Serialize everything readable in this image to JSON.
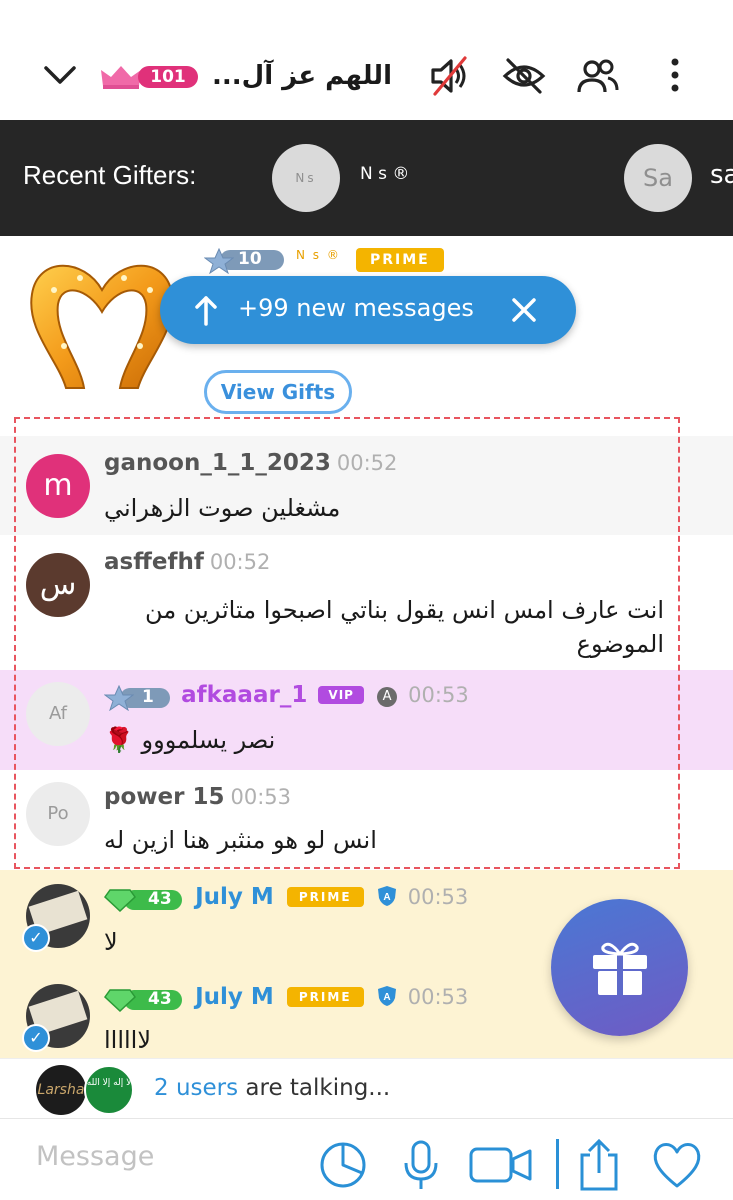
{
  "header": {
    "room_title": "اللهم عز آل...",
    "level": "101",
    "icons": [
      "chevron-down-icon",
      "crown-icon",
      "mute-speaker-icon",
      "eye-off-icon",
      "users-icon",
      "more-vertical-icon"
    ]
  },
  "gifters": {
    "label": "Recent Gifters:",
    "items": [
      {
        "initials": "Ns",
        "name": "N s ®"
      },
      {
        "initials": "Sa",
        "name": "sa"
      }
    ]
  },
  "gift_message": {
    "star_level": "10",
    "name": "N s ®",
    "badge": "PRIME",
    "view_gifts": "View Gifts"
  },
  "new_messages": {
    "label": "+99 new messages"
  },
  "messages": [
    {
      "initial": "m",
      "avatar_color": "#e0317a",
      "username": "ganoon_1_1_2023",
      "time": "00:52",
      "text": "مشغلين صوت الزهراني"
    },
    {
      "initial": "س",
      "avatar_color": "#5b3a2e",
      "username": "asffefhf",
      "time": "00:52",
      "text": "انت عارف امس انس يقول  بناتي اصبحوا متاثرين من الموضوع"
    },
    {
      "initial": "Af",
      "avatar_color": "#ececec",
      "star_level": "1",
      "username": "afkaaar_1",
      "badge": "VIP",
      "time": "00:53",
      "text": "نصر يسلمووو 🌹"
    },
    {
      "initial": "Po",
      "avatar_color": "#ececec",
      "username": "power 15",
      "time": "00:53",
      "text": "انس لو هو منثبر هنا ازين له"
    },
    {
      "username": "July M",
      "level": "43",
      "badge": "PRIME",
      "time": "00:53",
      "text": "لا"
    },
    {
      "username": "July M",
      "level": "43",
      "badge": "PRIME",
      "time": "00:53",
      "text": "لاااااا"
    }
  ],
  "typing": {
    "count": "2 users",
    "rest": " are talking...",
    "avatar1": "Larsha",
    "avatar2": "لا إله إلا الله"
  },
  "composer": {
    "placeholder": "Message",
    "icons": [
      "sticker-icon",
      "microphone-icon",
      "video-camera-icon",
      "share-icon",
      "heart-icon"
    ]
  },
  "colors": {
    "accent_blue": "#2f90d8",
    "prime_gold": "#f4b400",
    "vip_purple": "#b14be0",
    "level_pink": "#e0317a",
    "gem_green": "#3dbb4a"
  }
}
